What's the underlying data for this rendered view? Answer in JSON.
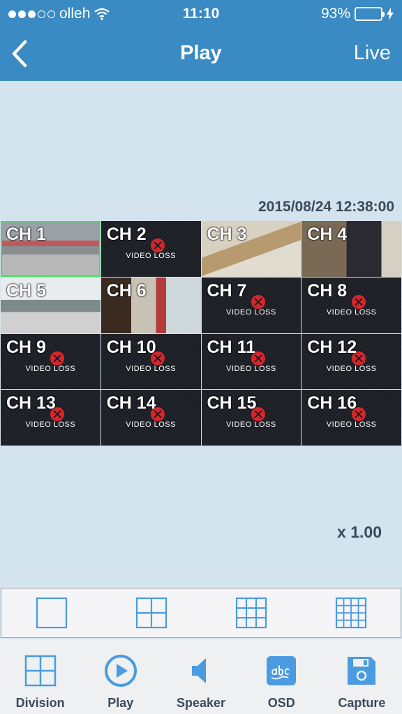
{
  "status": {
    "carrier": "olleh",
    "time": "11:10",
    "battery": "93%",
    "battery_level": 0.93,
    "signal_bars": 3
  },
  "nav": {
    "title": "Play",
    "right_label": "Live",
    "back_icon": "chevron-left-icon"
  },
  "timestamp": "2015/08/24 12:38:00",
  "video_loss_text": "VIDEO LOSS",
  "channels": [
    {
      "label": "CH 1",
      "state": "live"
    },
    {
      "label": "CH 2",
      "state": "video-loss"
    },
    {
      "label": "CH 3",
      "state": "live"
    },
    {
      "label": "CH 4",
      "state": "live"
    },
    {
      "label": "CH 5",
      "state": "live"
    },
    {
      "label": "CH 6",
      "state": "live"
    },
    {
      "label": "CH 7",
      "state": "video-loss"
    },
    {
      "label": "CH 8",
      "state": "video-loss"
    },
    {
      "label": "CH 9",
      "state": "video-loss"
    },
    {
      "label": "CH 10",
      "state": "video-loss"
    },
    {
      "label": "CH 11",
      "state": "video-loss"
    },
    {
      "label": "CH 12",
      "state": "video-loss"
    },
    {
      "label": "CH 13",
      "state": "video-loss"
    },
    {
      "label": "CH 14",
      "state": "video-loss"
    },
    {
      "label": "CH 15",
      "state": "video-loss"
    },
    {
      "label": "CH 16",
      "state": "video-loss"
    }
  ],
  "selected_channel": "CH 1",
  "zoom": "x 1.00",
  "division_options": [
    "1x1",
    "2x2",
    "3x3",
    "4x4"
  ],
  "tabs": [
    {
      "label": "Division",
      "icon": "division-grid-icon"
    },
    {
      "label": "Play",
      "icon": "play-circle-icon"
    },
    {
      "label": "Speaker",
      "icon": "speaker-icon"
    },
    {
      "label": "OSD",
      "icon": "osd-abc-icon"
    },
    {
      "label": "Capture",
      "icon": "save-disk-icon"
    }
  ],
  "colors": {
    "header": "#3a8ac4",
    "background": "#d3e4ee",
    "accent": "#4a9be0",
    "selected_border": "#3ee05a",
    "video_loss_mark": "#d7262b"
  }
}
